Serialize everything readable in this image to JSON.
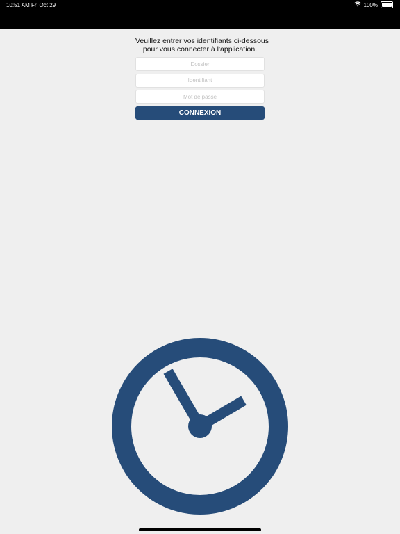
{
  "status_bar": {
    "time": "10:51 AM",
    "date": "Fri Oct 29",
    "battery": "100%",
    "battery_level": 1.0
  },
  "login": {
    "intro_line1": "Veuillez entrer vos identifiants ci-dessous",
    "intro_line2": "pour vous connecter à l'application.",
    "fields": {
      "dossier": {
        "placeholder": "Dossier",
        "value": ""
      },
      "identifiant": {
        "placeholder": "Identifiant",
        "value": ""
      },
      "password": {
        "placeholder": "Mot de passe",
        "value": ""
      }
    },
    "button_label": "CONNEXION"
  },
  "logo": {
    "icon": "clock-icon"
  },
  "colors": {
    "brand": "#264c79",
    "background": "#efefef",
    "status_bar": "#000000"
  }
}
